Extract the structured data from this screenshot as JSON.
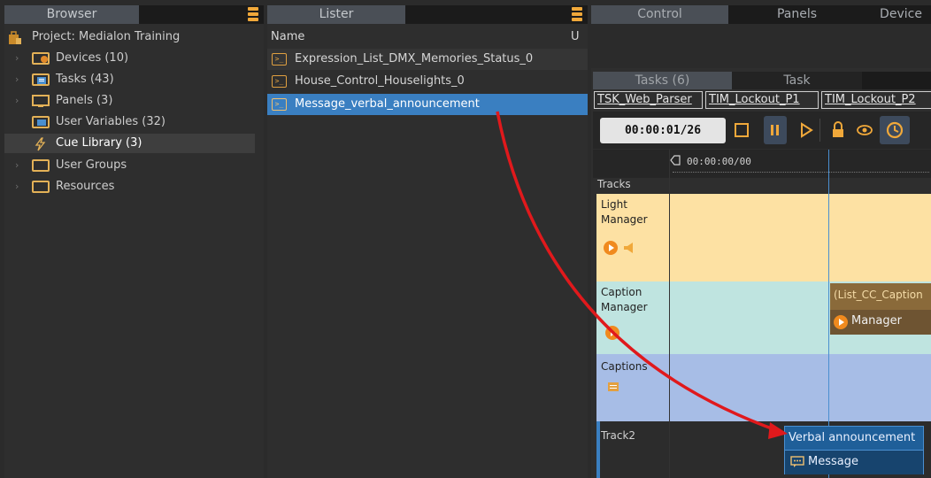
{
  "browser": {
    "title": "Browser",
    "items": [
      {
        "label": "Project: Medialon Training",
        "icon": "project-icon"
      },
      {
        "label": "Devices (10)",
        "icon": "devices-folder-icon"
      },
      {
        "label": "Tasks (43)",
        "icon": "tasks-folder-icon"
      },
      {
        "label": "Panels (3)",
        "icon": "panels-icon"
      },
      {
        "label": "User Variables (32)",
        "icon": "variables-folder-icon"
      },
      {
        "label": "Cue Library (3)",
        "icon": "lightning-icon"
      },
      {
        "label": "User Groups",
        "icon": "folder-icon"
      },
      {
        "label": "Resources",
        "icon": "folder-icon"
      }
    ]
  },
  "lister": {
    "title": "Lister",
    "col_name": "Name",
    "col_u": "U",
    "rows": [
      {
        "label": "Expression_List_DMX_Memories_Status_0",
        "icon_text": ">_"
      },
      {
        "label": "House_Control_Houselights_0",
        "icon_text": ">_"
      },
      {
        "label": "Message_verbal_announcement",
        "icon_text": ">_"
      }
    ]
  },
  "control": {
    "tabs": [
      "Control",
      "Panels",
      "Device"
    ],
    "subtabs": [
      "Tasks (6)",
      "Task"
    ],
    "task_chips": [
      "TSK_Web_Parser",
      "TIM_Lockout_P1",
      "TIM_Lockout_P2"
    ],
    "time": "00:00:01/26",
    "ruler_time": "00:00:00/00",
    "tracks_label": "Tracks",
    "tracks": [
      {
        "name": "Light\nManager",
        "color": "#fde1a3"
      },
      {
        "name": "Caption\nManager",
        "color": "#bfe4e0"
      },
      {
        "name": "Captions",
        "color": "#a7bde6"
      },
      {
        "name": "Track2",
        "color": "#2c2c2c"
      }
    ],
    "cue_caption_title": "(List_CC_Caption",
    "cue_caption_sub": "Manager",
    "cue_verbal_title": "Verbal announcement",
    "cue_verbal_sub": "Message"
  },
  "colors": {
    "accent": "#f0a83a",
    "selection": "#3a7fc1",
    "arrow": "#e0191c"
  }
}
